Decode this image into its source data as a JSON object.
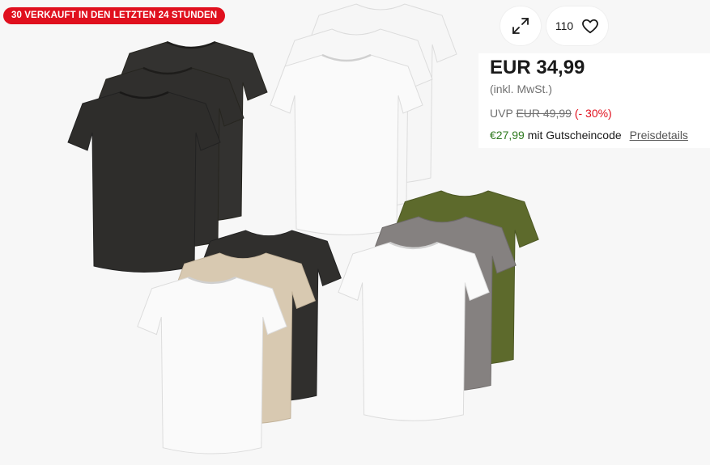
{
  "badge": {
    "sold_text": "30 VERKAUFT IN DEN LETZTEN 24 STUNDEN"
  },
  "actions": {
    "watch_count": "110"
  },
  "price": {
    "main": "EUR 34,99",
    "tax_note": "(inkl. MwSt.)",
    "uvp_label": "UVP",
    "uvp_old": "EUR 49,99",
    "uvp_discount": "(- 30%)",
    "coupon_price": "€27,99",
    "coupon_text": "mit Gutscheincode",
    "details_link": "Preisdetails"
  },
  "icons": {
    "expand": "expand-icon",
    "heart": "heart-icon"
  },
  "colors": {
    "badge_red": "#e0101e",
    "discount_red": "#e0101e",
    "coupon_green": "#2f7a1f",
    "shirt_black": "#2f2e2c",
    "shirt_white": "#f4f4f4",
    "shirt_beige": "#d8c9b1",
    "shirt_olive": "#5d6a2c",
    "shirt_grey": "#858180"
  }
}
